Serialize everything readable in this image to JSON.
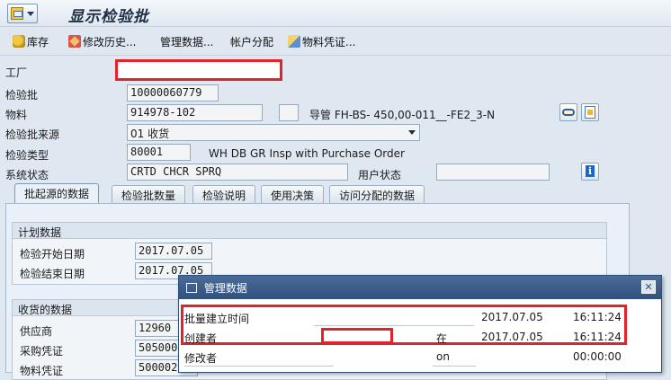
{
  "window": {
    "title": "显示检验批"
  },
  "toolbar": {
    "items": [
      {
        "label": "库存",
        "icon": "stock-icon"
      },
      {
        "label": "修改历史...",
        "icon": "pencil-icon"
      },
      {
        "label": "管理数据..."
      },
      {
        "label": "帐户分配"
      },
      {
        "label": "物料凭证...",
        "icon": "doc-icon"
      }
    ]
  },
  "header": {
    "plant_label": "工厂",
    "lot_label": "检验批",
    "lot_value": "10000060779",
    "material_label": "物料",
    "material_value": "914978-102",
    "material_desc": "导管 FH-BS- 450,00-011__-FE2_3-N",
    "origin_label": "检验批来源",
    "origin_value": "01 收货",
    "type_label": "检验类型",
    "type_value": "80001",
    "type_desc": "WH DB GR Insp with Purchase Order",
    "status_label": "系统状态",
    "status_value": "CRTD CHCR SPRQ",
    "user_status_label": "用户状态",
    "user_status_value": ""
  },
  "tabs": [
    {
      "label": "批起源的数据",
      "active": true
    },
    {
      "label": "检验批数量"
    },
    {
      "label": "检验说明"
    },
    {
      "label": "使用决策"
    },
    {
      "label": "访问分配的数据"
    }
  ],
  "plan_group": {
    "title": "计划数据",
    "start_label": "检验开始日期",
    "start_value": "2017.07.05",
    "end_label": "检验结束日期",
    "end_value": "2017.07.05"
  },
  "receipt_group": {
    "title": "收货的数据",
    "vendor_label": "供应商",
    "vendor_value": "12960",
    "po_label": "采购凭证",
    "po_value": "505000",
    "matdoc_label": "物料凭证",
    "matdoc_value": "500002"
  },
  "popup": {
    "title": "管理数据",
    "rows": [
      {
        "label": "批量建立时间",
        "mid": "",
        "date": "2017.07.05",
        "time": "16:11:24"
      },
      {
        "label": "创建者",
        "mid": "在",
        "date": "2017.07.05",
        "time": "16:11:24"
      },
      {
        "label": "修改者",
        "mid": "on",
        "date": "",
        "time": "00:00:00"
      }
    ]
  },
  "colors": {
    "highlight": "#e2232a",
    "popup_header": "#3b5d8a"
  }
}
